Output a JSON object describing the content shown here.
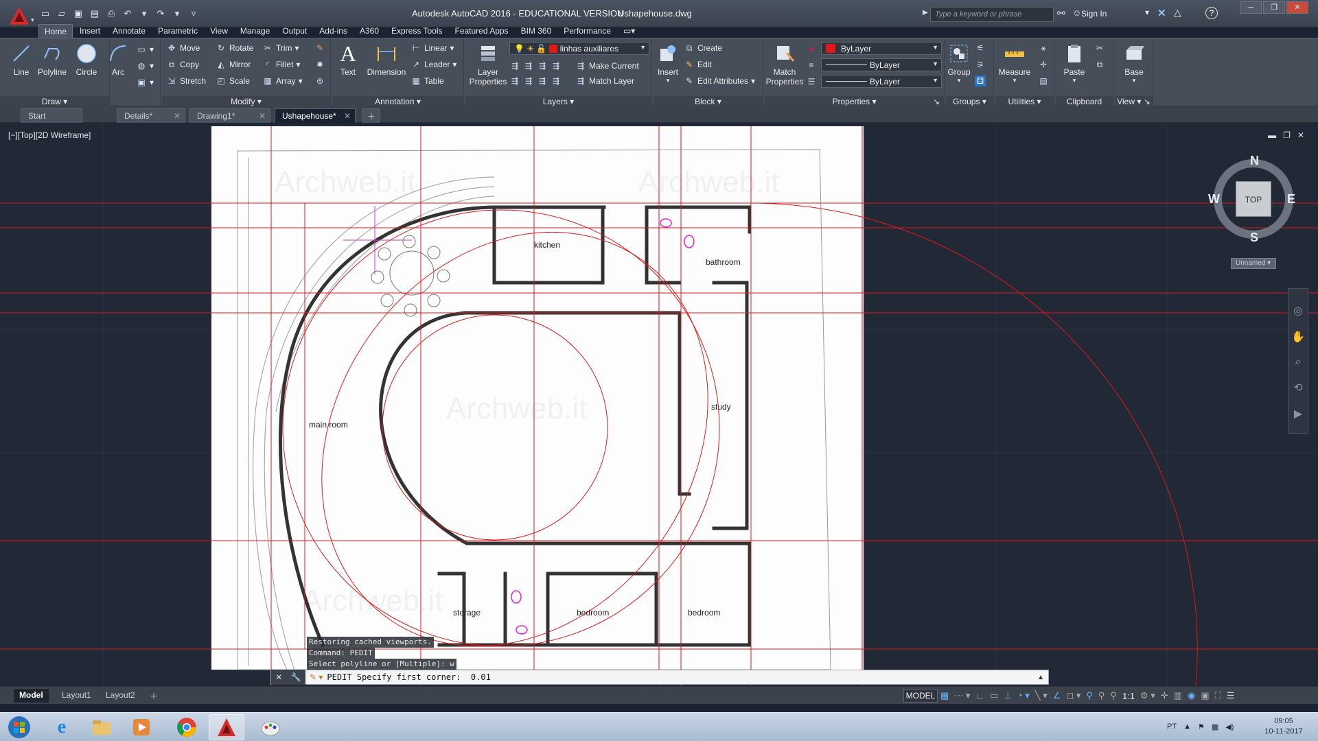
{
  "window": {
    "title": "Autodesk AutoCAD 2016 - EDUCATIONAL VERSION",
    "file": "Ushapehouse.dwg",
    "search_placeholder": "Type a keyword or phrase",
    "sign_in": "Sign In",
    "help": "?"
  },
  "ribbon_tabs": [
    "Home",
    "Insert",
    "Annotate",
    "Parametric",
    "View",
    "Manage",
    "Output",
    "Add-ins",
    "A360",
    "Express Tools",
    "Featured Apps",
    "BIM 360",
    "Performance"
  ],
  "draw": {
    "title": "Draw",
    "line": "Line",
    "polyline": "Polyline",
    "circle": "Circle",
    "arc": "Arc"
  },
  "modify": {
    "title": "Modify",
    "move": "Move",
    "rotate": "Rotate",
    "trim": "Trim",
    "copy": "Copy",
    "mirror": "Mirror",
    "fillet": "Fillet",
    "stretch": "Stretch",
    "scale": "Scale",
    "array": "Array"
  },
  "annotation": {
    "title": "Annotation",
    "text": "Text",
    "dimension": "Dimension",
    "linear": "Linear",
    "leader": "Leader",
    "table": "Table"
  },
  "layers": {
    "title": "Layers",
    "layer_properties": "Layer Properties",
    "current_layer": "linhas auxiliares",
    "make_current": "Make Current",
    "match_layer": "Match Layer"
  },
  "block": {
    "title": "Block",
    "insert": "Insert",
    "create": "Create",
    "edit": "Edit",
    "edit_attributes": "Edit Attributes"
  },
  "properties": {
    "title": "Properties",
    "match_properties": "Match Properties",
    "color": "ByLayer",
    "linetype": "ByLayer",
    "lineweight": "ByLayer"
  },
  "groups": {
    "title": "Groups",
    "group": "Group"
  },
  "utilities": {
    "title": "Utilities",
    "measure": "Measure"
  },
  "clipboard": {
    "title": "Clipboard",
    "paste": "Paste"
  },
  "view_panel": {
    "title": "View",
    "base": "Base"
  },
  "doc_tabs": [
    "Start",
    "Details*",
    "Drawing1*",
    "Ushapehouse*"
  ],
  "viewport_label": "[−][Top][2D Wireframe]",
  "rooms": {
    "kitchen": "kitchen",
    "bathroom": "bathroom",
    "main_room": "main room",
    "study": "study",
    "storage": "storage",
    "bedroom1": "bedroom",
    "bedroom2": "bedroom"
  },
  "watermark": "Archweb.it",
  "viewcube": {
    "n": "N",
    "s": "S",
    "w": "W",
    "e": "E",
    "top": "TOP",
    "ucs": "Unnamed"
  },
  "command": {
    "history": [
      "Restoring cached viewports.",
      "Command: PEDIT",
      "Select polyline or [Multiple]: w"
    ],
    "prompt": "PEDIT Specify first corner:  0.01"
  },
  "layout_tabs": [
    "Model",
    "Layout1",
    "Layout2"
  ],
  "status": {
    "model": "MODEL",
    "scale": "1:1"
  },
  "tray": {
    "lang": "PT",
    "time": "09:05",
    "date": "10-11-2017"
  },
  "colors": {
    "accent": "#cc2222",
    "autocad_red": "#d42a2a",
    "guide_red": "#e01818"
  }
}
